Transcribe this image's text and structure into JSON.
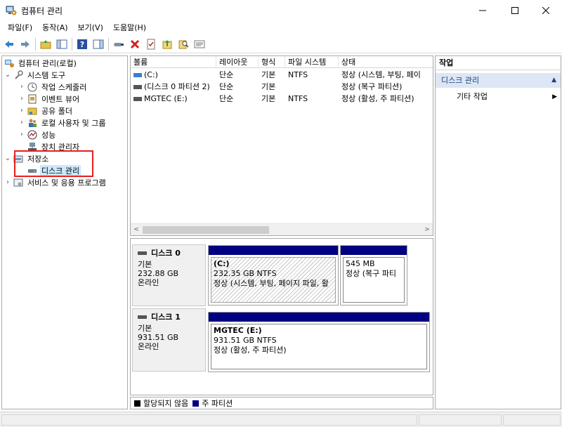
{
  "window": {
    "title": "컴퓨터 관리"
  },
  "menu": [
    "파일(F)",
    "동작(A)",
    "보기(V)",
    "도움말(H)"
  ],
  "toolbar": [
    "back-icon",
    "forward-icon",
    "up-folder-icon",
    "show-hide-tree-icon",
    "help-icon",
    "show-hide-action-icon",
    "connect-icon",
    "delete-icon",
    "properties-icon",
    "export-icon",
    "search-icon",
    "details-icon"
  ],
  "tree": {
    "root": "컴퓨터 관리(로컬)",
    "system_tools": "시스템 도구",
    "task_scheduler": "작업 스케줄러",
    "event_viewer": "이벤트 뷰어",
    "shared_folders": "공유 폴더",
    "local_users": "로컬 사용자 및 그룹",
    "performance": "성능",
    "device_manager": "장치 관리자",
    "storage": "저장소",
    "disk_management": "디스크 관리",
    "services": "서비스 및 응용 프로그램"
  },
  "volumes": {
    "columns": [
      "볼륨",
      "레이아웃",
      "형식",
      "파일 시스템",
      "상태"
    ],
    "rows": [
      {
        "volume": "(C:)",
        "layout": "단순",
        "type": "기본",
        "fs": "NTFS",
        "status": "정상 (시스템, 부팅, 페이"
      },
      {
        "volume": "(디스크 0 파티션 2)",
        "layout": "단순",
        "type": "기본",
        "fs": "",
        "status": "정상 (복구 파티션)"
      },
      {
        "volume": "MGTEC (E:)",
        "layout": "단순",
        "type": "기본",
        "fs": "NTFS",
        "status": "정상 (활성, 주 파티션)"
      }
    ]
  },
  "disks": [
    {
      "name": "디스크 0",
      "type": "기본",
      "size": "232.88 GB",
      "state": "온라인",
      "partitions": [
        {
          "title": "(C:)",
          "size": "232.35 GB NTFS",
          "status": "정상 (시스템, 부팅, 페이지 파일, 활"
        },
        {
          "title": "",
          "size": "545 MB",
          "status": "정상 (복구 파티"
        }
      ]
    },
    {
      "name": "디스크 1",
      "type": "기본",
      "size": "931.51 GB",
      "state": "온라인",
      "partitions": [
        {
          "title": "MGTEC  (E:)",
          "size": "931.51 GB NTFS",
          "status": "정상 (활성, 주 파티션)"
        }
      ]
    }
  ],
  "legend": {
    "unallocated": "할당되지 않음",
    "primary": "주 파티션",
    "unallocated_color": "#000000",
    "primary_color": "#000080"
  },
  "actions": {
    "header": "작업",
    "section": "디스크 관리",
    "more": "기타 작업"
  },
  "colors": {
    "partition_bar": "#000080",
    "selection": "#cce8ff",
    "highlight_box": "#e81e1e"
  }
}
